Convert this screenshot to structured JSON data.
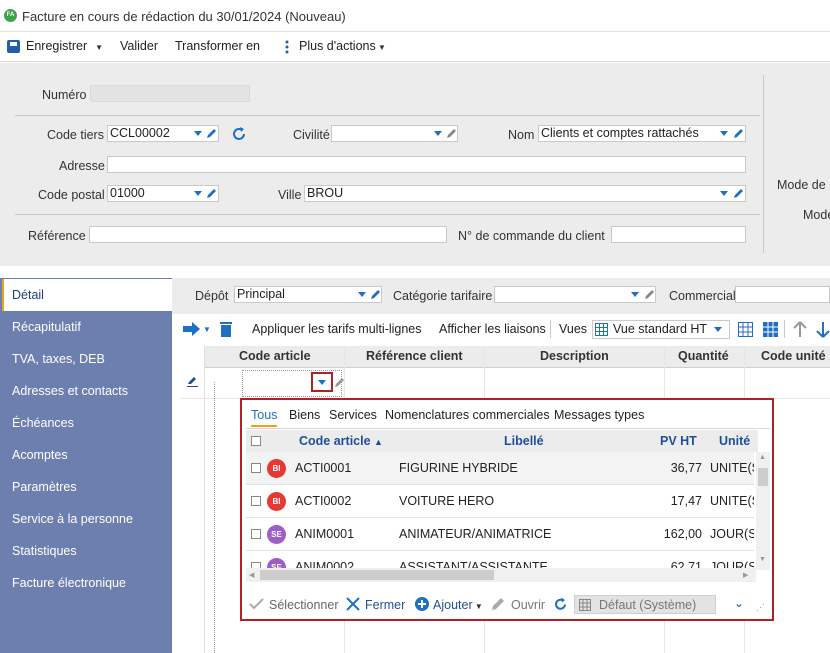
{
  "window": {
    "title": "Facture en cours de rédaction du 30/01/2024 (Nouveau)",
    "badge": "FA"
  },
  "toolbar": {
    "save_label": "Enregistrer",
    "validate_label": "Valider",
    "transform_label": "Transformer en",
    "more_label": "Plus d'actions"
  },
  "form": {
    "numero_label": "Numéro",
    "numero_value": "",
    "code_tiers_label": "Code tiers",
    "code_tiers_value": "CCL00002",
    "civilite_label": "Civilité",
    "civilite_value": "",
    "nom_label": "Nom",
    "nom_value": "Clients et comptes rattachés",
    "adresse_label": "Adresse",
    "adresse_value": "",
    "code_postal_label": "Code postal",
    "code_postal_value": "01000",
    "ville_label": "Ville",
    "ville_value": "BROU",
    "reference_label": "Référence",
    "reference_value": "",
    "commande_label": "N° de commande du client",
    "commande_value": "",
    "right_label_1": "Mode de r",
    "right_label_2": "Mode"
  },
  "sidebar": {
    "items": [
      {
        "label": "Détail",
        "active": true
      },
      {
        "label": "Récapitulatif"
      },
      {
        "label": "TVA, taxes, DEB"
      },
      {
        "label": "Adresses et contacts"
      },
      {
        "label": "Échéances"
      },
      {
        "label": "Acomptes"
      },
      {
        "label": "Paramètres"
      },
      {
        "label": "Service à la personne"
      },
      {
        "label": "Statistiques"
      },
      {
        "label": "Facture électronique"
      }
    ]
  },
  "detail": {
    "depot_label": "Dépôt",
    "depot_value": "Principal",
    "categorie_label": "Catégorie tarifaire",
    "categorie_value": "",
    "commercial_label": "Commercial",
    "commercial_value": "",
    "apply_label": "Appliquer les tarifs multi-lignes",
    "links_label": "Afficher les liaisons",
    "views_label": "Vues",
    "view_value": "Vue standard HT",
    "columns": [
      "Code article",
      "Référence client",
      "Description",
      "Quantité",
      "Code unité"
    ]
  },
  "popup": {
    "tabs": [
      "Tous",
      "Biens",
      "Services",
      "Nomenclatures commerciales",
      "Messages types"
    ],
    "columns": {
      "code": "Code article",
      "libelle": "Libellé",
      "pv": "PV HT",
      "unite": "Unité"
    },
    "rows": [
      {
        "badge": "BI",
        "badge_color": "#e53935",
        "code": "ACTI0001",
        "libelle": "FIGURINE HYBRIDE",
        "pv": "36,77",
        "unite": "UNITE(S"
      },
      {
        "badge": "BI",
        "badge_color": "#e53935",
        "code": "ACTI0002",
        "libelle": "VOITURE HERO",
        "pv": "17,47",
        "unite": "UNITE(S"
      },
      {
        "badge": "SE",
        "badge_color": "#9c5fc8",
        "code": "ANIM0001",
        "libelle": "ANIMATEUR/ANIMATRICE",
        "pv": "162,00",
        "unite": "JOUR(S)"
      },
      {
        "badge": "SE",
        "badge_color": "#9c5fc8",
        "code": "ANIM0002",
        "libelle": "ASSISTANT/ASSISTANTE",
        "pv": "62,71",
        "unite": "JOUR(S)"
      }
    ],
    "footer": {
      "select_label": "Sélectionner",
      "close_label": "Fermer",
      "add_label": "Ajouter",
      "open_label": "Ouvrir",
      "view_value": "Défaut (Système)"
    }
  },
  "colors": {
    "accent": "#1f6fc2",
    "sidebar": "#6d7fae",
    "popup_border": "#b32024",
    "active_tab": "#f0a020"
  }
}
